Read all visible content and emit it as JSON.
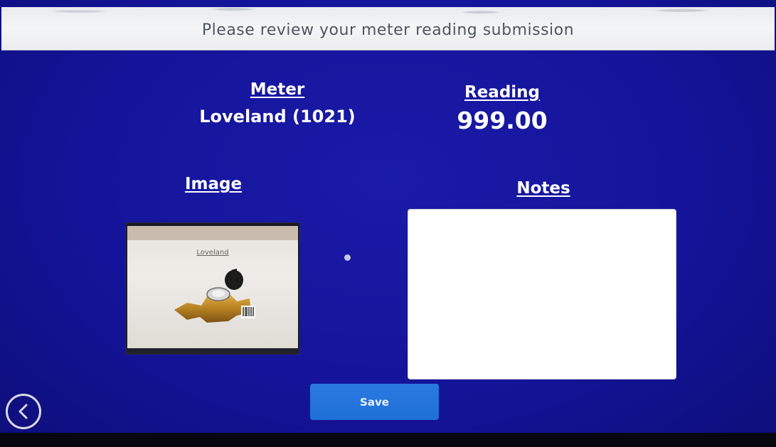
{
  "header": {
    "title": "Please review your meter reading submission"
  },
  "meter": {
    "label": "Meter",
    "value": "Loveland (1021)"
  },
  "reading": {
    "label": "Reading",
    "value": "999.00"
  },
  "image_section": {
    "label": "Image",
    "photo_caption": "Loveland"
  },
  "notes": {
    "label": "Notes",
    "value": ""
  },
  "actions": {
    "save_label": "Save",
    "back_icon": "chevron-left-icon"
  },
  "colors": {
    "background": "#14149a",
    "header_bg": "#f0f1f3",
    "save_button": "#1f6fd8",
    "text": "#ffffff"
  }
}
